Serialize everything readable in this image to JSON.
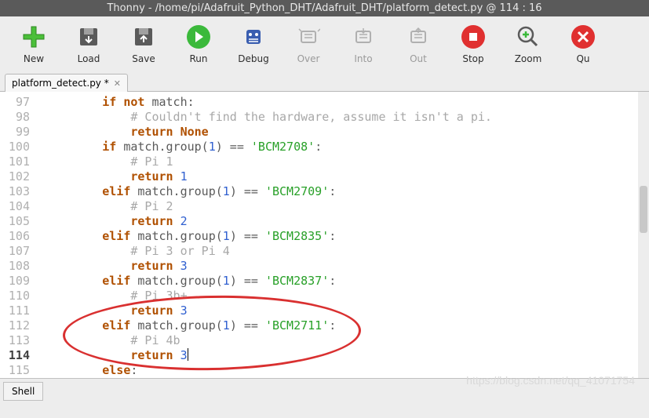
{
  "titlebar": "Thonny  -  /home/pi/Adafruit_Python_DHT/Adafruit_DHT/platform_detect.py  @  114 : 16",
  "toolbar": {
    "new_label": "New",
    "load_label": "Load",
    "save_label": "Save",
    "run_label": "Run",
    "debug_label": "Debug",
    "over_label": "Over",
    "into_label": "Into",
    "out_label": "Out",
    "stop_label": "Stop",
    "zoom_label": "Zoom",
    "quit_label": "Qu"
  },
  "tab": {
    "name": "platform_detect.py *",
    "close": "✕"
  },
  "file_path": "/home/pi/Adafruit_Python_DHT/Adafruit_DHT/platform_detect.py",
  "cursor": {
    "line": 114,
    "col": 16
  },
  "lines": [
    {
      "n": 97,
      "code": [
        [
          "kw",
          "if"
        ],
        [
          "op",
          " "
        ],
        [
          "kw",
          "not"
        ],
        [
          "op",
          " match:"
        ]
      ]
    },
    {
      "n": 98,
      "code": [
        [
          "cmt",
          "    # Couldn't find the hardware, assume it isn't a pi."
        ]
      ]
    },
    {
      "n": 99,
      "code": [
        [
          "op",
          "    "
        ],
        [
          "kw",
          "return"
        ],
        [
          "op",
          " "
        ],
        [
          "kw",
          "None"
        ]
      ]
    },
    {
      "n": 100,
      "code": [
        [
          "kw",
          "if"
        ],
        [
          "op",
          " match.group("
        ],
        [
          "num",
          "1"
        ],
        [
          "op",
          ") == "
        ],
        [
          "str",
          "'BCM2708'"
        ],
        [
          "op",
          ":"
        ]
      ]
    },
    {
      "n": 101,
      "code": [
        [
          "cmt",
          "    # Pi 1"
        ]
      ]
    },
    {
      "n": 102,
      "code": [
        [
          "op",
          "    "
        ],
        [
          "kw",
          "return"
        ],
        [
          "op",
          " "
        ],
        [
          "num",
          "1"
        ]
      ]
    },
    {
      "n": 103,
      "code": [
        [
          "kw",
          "elif"
        ],
        [
          "op",
          " match.group("
        ],
        [
          "num",
          "1"
        ],
        [
          "op",
          ") == "
        ],
        [
          "str",
          "'BCM2709'"
        ],
        [
          "op",
          ":"
        ]
      ]
    },
    {
      "n": 104,
      "code": [
        [
          "cmt",
          "    # Pi 2"
        ]
      ]
    },
    {
      "n": 105,
      "code": [
        [
          "op",
          "    "
        ],
        [
          "kw",
          "return"
        ],
        [
          "op",
          " "
        ],
        [
          "num",
          "2"
        ]
      ]
    },
    {
      "n": 106,
      "code": [
        [
          "kw",
          "elif"
        ],
        [
          "op",
          " match.group("
        ],
        [
          "num",
          "1"
        ],
        [
          "op",
          ") == "
        ],
        [
          "str",
          "'BCM2835'"
        ],
        [
          "op",
          ":"
        ]
      ]
    },
    {
      "n": 107,
      "code": [
        [
          "cmt",
          "    # Pi 3 or Pi 4"
        ]
      ]
    },
    {
      "n": 108,
      "code": [
        [
          "op",
          "    "
        ],
        [
          "kw",
          "return"
        ],
        [
          "op",
          " "
        ],
        [
          "num",
          "3"
        ]
      ]
    },
    {
      "n": 109,
      "code": [
        [
          "kw",
          "elif"
        ],
        [
          "op",
          " match.group("
        ],
        [
          "num",
          "1"
        ],
        [
          "op",
          ") == "
        ],
        [
          "str",
          "'BCM2837'"
        ],
        [
          "op",
          ":"
        ]
      ]
    },
    {
      "n": 110,
      "code": [
        [
          "cmt",
          "    # Pi 3b+"
        ]
      ]
    },
    {
      "n": 111,
      "code": [
        [
          "op",
          "    "
        ],
        [
          "kw",
          "return"
        ],
        [
          "op",
          " "
        ],
        [
          "num",
          "3"
        ]
      ]
    },
    {
      "n": 112,
      "code": [
        [
          "kw",
          "elif"
        ],
        [
          "op",
          " match.group("
        ],
        [
          "num",
          "1"
        ],
        [
          "op",
          ") == "
        ],
        [
          "str",
          "'BCM2711'"
        ],
        [
          "op",
          ":"
        ]
      ]
    },
    {
      "n": 113,
      "code": [
        [
          "cmt",
          "    # Pi 4b"
        ]
      ]
    },
    {
      "n": 114,
      "code": [
        [
          "op",
          "    "
        ],
        [
          "kw",
          "return"
        ],
        [
          "op",
          " "
        ],
        [
          "num",
          "3"
        ]
      ],
      "current": true
    },
    {
      "n": 115,
      "code": [
        [
          "kw",
          "else"
        ],
        [
          "op",
          ":"
        ]
      ]
    }
  ],
  "base_indent": "        ",
  "bottom_tab": "Shell",
  "watermark": "https://blog.csdn.net/qq_41071754"
}
